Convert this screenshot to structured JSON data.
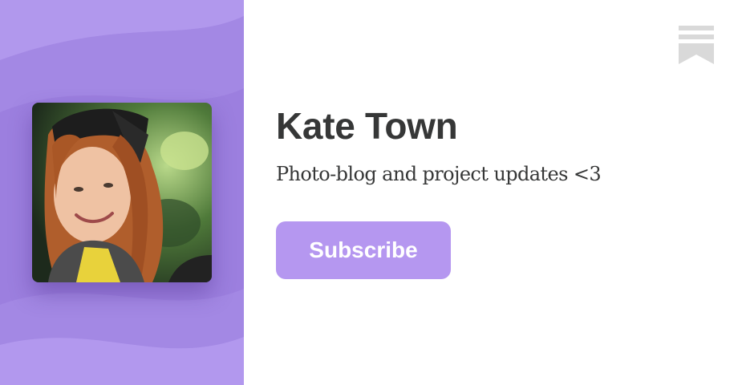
{
  "profile": {
    "name": "Kate Town",
    "tagline": "Photo-blog and project updates <3",
    "subscribe_label": "Subscribe",
    "avatar_description": "profile-photo"
  },
  "brand": {
    "logo_icon": "substack-bookmark-icon"
  },
  "colors": {
    "panel_background": "#9c7fdf",
    "button_background": "#b597f0",
    "button_text": "#ffffff",
    "text_primary": "#363737",
    "logo": "#d9d9d9"
  }
}
